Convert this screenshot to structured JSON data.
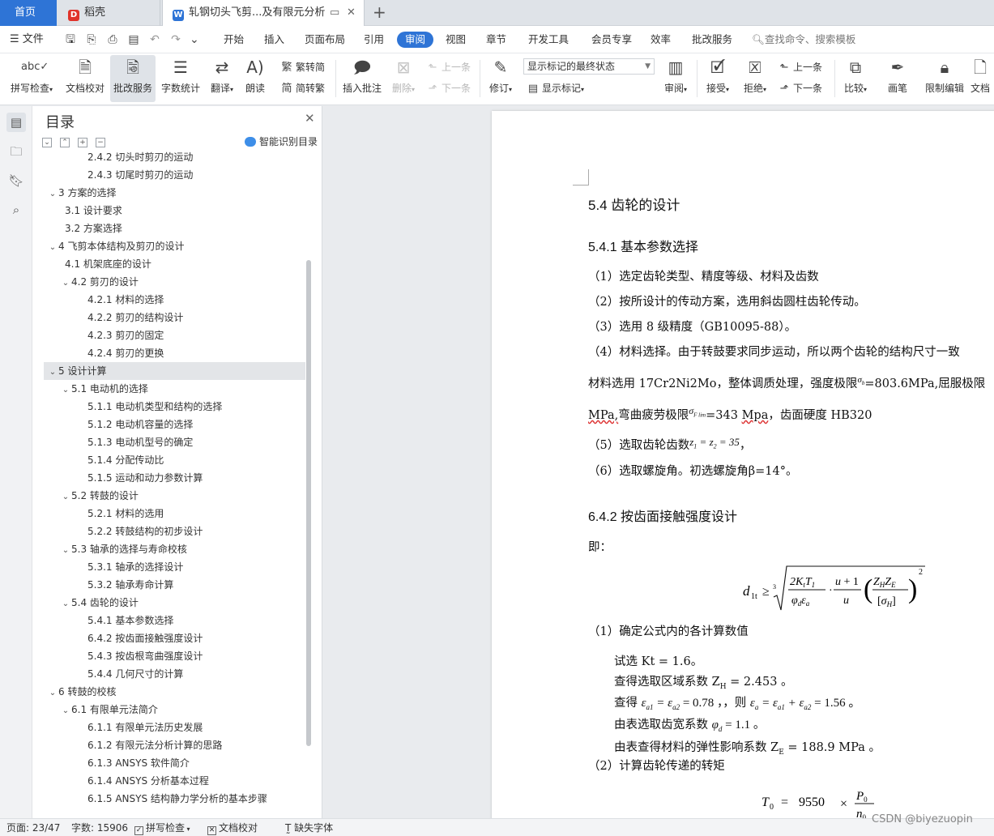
{
  "tabs": {
    "home": "首页",
    "daoke": "稻壳",
    "doc": "轧钢切头飞剪...及有限元分析"
  },
  "menu": {
    "file": "文件",
    "items": [
      "开始",
      "插入",
      "页面布局",
      "引用",
      "审阅",
      "视图",
      "章节",
      "开发工具",
      "会员专享",
      "效率",
      "批改服务"
    ],
    "active_index": 4,
    "search": "查找命令、搜索模板"
  },
  "ribbon": {
    "spell": "拼写检查",
    "doc_check": "文档校对",
    "review_service": "批改服务",
    "word_count": "字数统计",
    "translate": "翻译",
    "read_aloud": "朗读",
    "to_simplified": "繁转简",
    "to_traditional": "简转繁",
    "insert_comment": "插入批注",
    "delete": "删除",
    "prev": "上一条",
    "next": "下一条",
    "track": "修订",
    "markup_select": "显示标记的最终状态",
    "show_markup": "显示标记",
    "review": "审阅",
    "accept": "接受",
    "reject": "拒绝",
    "prev2": "上一条",
    "next2": "下一条",
    "compare": "比较",
    "pen": "画笔",
    "restrict": "限制编辑",
    "doc_more": "文档"
  },
  "toc": {
    "title": "目录",
    "smart": "智能识别目录",
    "items": [
      {
        "text": "2.4.2  切头时剪刃的运动",
        "level": 3
      },
      {
        "text": "2.4.3  切尾时剪刃的运动",
        "level": 3
      },
      {
        "text": "3  方案的选择",
        "level": 1,
        "arrow": "v"
      },
      {
        "text": "3.1  设计要求",
        "level": 2
      },
      {
        "text": "3.2  方案选择",
        "level": 2
      },
      {
        "text": "4 飞剪本体结构及剪刃的设计",
        "level": 1,
        "arrow": "v"
      },
      {
        "text": "4.1 机架底座的设计",
        "level": 2
      },
      {
        "text": "4.2 剪刃的设计",
        "level": 2,
        "arrow": "v"
      },
      {
        "text": "4.2.1 材料的选择",
        "level": 3
      },
      {
        "text": "4.2.2 剪刃的结构设计",
        "level": 3
      },
      {
        "text": "4.2.3 剪刃的固定",
        "level": 3
      },
      {
        "text": "4.2.4  剪刃的更换",
        "level": 3
      },
      {
        "text": "5  设计计算",
        "level": 1,
        "arrow": "v",
        "selected": true
      },
      {
        "text": "5.1 电动机的选择",
        "level": 2,
        "arrow": "v"
      },
      {
        "text": "5.1.1 电动机类型和结构的选择",
        "level": 3
      },
      {
        "text": "5.1.2  电动机容量的选择",
        "level": 3
      },
      {
        "text": "5.1.3  电动机型号的确定",
        "level": 3
      },
      {
        "text": "5.1.4  分配传动比",
        "level": 3
      },
      {
        "text": "5.1.5  运动和动力参数计算",
        "level": 3
      },
      {
        "text": "5.2  转鼓的设计",
        "level": 2,
        "arrow": "v"
      },
      {
        "text": "5.2.1  材料的选用",
        "level": 3
      },
      {
        "text": "5.2.2  转鼓结构的初步设计",
        "level": 3
      },
      {
        "text": "5.3 轴承的选择与寿命校核",
        "level": 2,
        "arrow": "v"
      },
      {
        "text": "5.3.1  轴承的选择设计",
        "level": 3
      },
      {
        "text": "5.3.2  轴承寿命计算",
        "level": 3
      },
      {
        "text": "5.4  齿轮的设计",
        "level": 2,
        "arrow": "v"
      },
      {
        "text": "5.4.1  基本参数选择",
        "level": 3
      },
      {
        "text": "6.4.2  按齿面接触强度设计",
        "level": 3
      },
      {
        "text": "5.4.3 按齿根弯曲强度设计",
        "level": 3
      },
      {
        "text": "5.4.4  几何尺寸的计算",
        "level": 3
      },
      {
        "text": "6  转鼓的校核",
        "level": 1,
        "arrow": "v"
      },
      {
        "text": "6.1 有限单元法简介",
        "level": 2,
        "arrow": "v"
      },
      {
        "text": "6.1.1  有限单元法历史发展",
        "level": 3
      },
      {
        "text": "6.1.2 有限元法分析计算的思路",
        "level": 3
      },
      {
        "text": "6.1.3    ANSYS 软件简介",
        "level": 3
      },
      {
        "text": "6.1.4    ANSYS 分析基本过程",
        "level": 3
      },
      {
        "text": "6.1.5 ANSYS 结构静力学分析的基本步骤",
        "level": 3
      }
    ]
  },
  "doc": {
    "h_54": "5.4  齿轮的设计",
    "h_541": "5.4.1  基本参数选择",
    "p1": "（1）选定齿轮类型、精度等级、材料及齿数",
    "p2": "（2）按所设计的传动方案，选用斜齿圆柱齿轮传动。",
    "p3": "（3）选用 8 级精度（GB10095-88）。",
    "p4": "（4）材料选择。由于转鼓要求同步运动，所以两个齿轮的结构尺寸一致",
    "p5a": "材料选用 17Cr2Ni2Mo，整体调质处理，强度极限",
    "p5b": "=803.6MPa,屈服极限",
    "p6a": "MPa,",
    "p6b": "弯曲疲劳极限",
    "p6c": "=343 ",
    "p6d": "Mpa",
    "p6e": "，齿面硬度 HB320",
    "p7a": "（5）选取齿轮齿数",
    "p7b": "，",
    "p8": "（6）选取螺旋角。初选螺旋角β=14°。",
    "h_642": "6.4.2  按齿面接触强度设计",
    "ji": "即：",
    "c1": "（1）确定公式内的各计算数值",
    "l1": "试选 Kt = 1.6。",
    "l2": "查得选取区域系数 Z",
    "l2b": " = 2.453 。",
    "l3a": "查得",
    "l3b": "，，则",
    "l4": "由表选取齿宽系数",
    "l4b": "。",
    "l5": "由表查得材料的弹性影响系数 Z",
    "l5b": " = 188.9 MPa 。",
    "c2": "（2）计算齿轮传递的转矩"
  },
  "status": {
    "page": "页面: 23/47",
    "words": "字数: 15906",
    "spell": "拼写检查",
    "proof": "文档校对",
    "missing_font": "缺失字体"
  },
  "watermark": "CSDN @biyezuopin"
}
